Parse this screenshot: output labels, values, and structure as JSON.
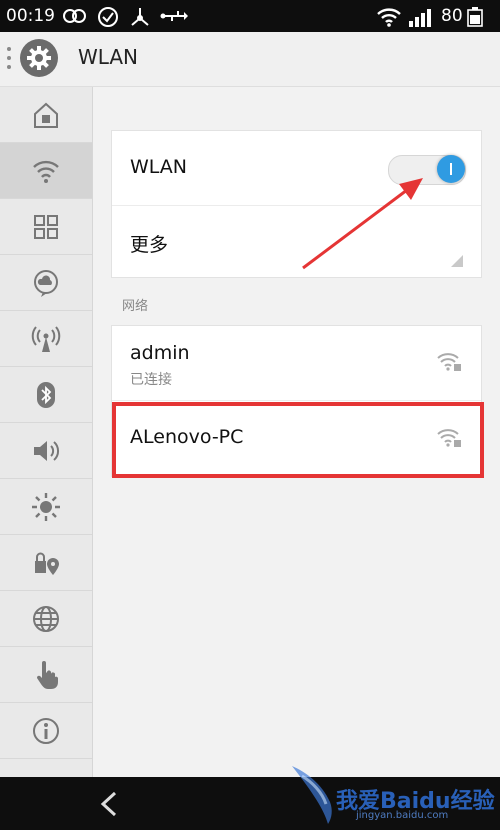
{
  "status_bar": {
    "time": "00:19",
    "battery": "80",
    "icons": [
      "infinity-icon",
      "check-circle-icon",
      "share-icon",
      "usb-icon",
      "wifi-icon",
      "signal-icon"
    ]
  },
  "header": {
    "title": "WLAN",
    "icon": "settings-gear-icon"
  },
  "sidebar": {
    "items": [
      {
        "name": "home-icon",
        "active": false
      },
      {
        "name": "wifi-icon",
        "active": true
      },
      {
        "name": "grid-icon",
        "active": false
      },
      {
        "name": "cloud-chat-icon",
        "active": false
      },
      {
        "name": "hotspot-icon",
        "active": false
      },
      {
        "name": "bluetooth-icon",
        "active": false
      },
      {
        "name": "volume-icon",
        "active": false
      },
      {
        "name": "brightness-icon",
        "active": false
      },
      {
        "name": "lock-location-icon",
        "active": false
      },
      {
        "name": "globe-icon",
        "active": false
      },
      {
        "name": "hand-icon",
        "active": false
      },
      {
        "name": "info-icon",
        "active": false
      }
    ]
  },
  "wlan_card": {
    "wlan_label": "WLAN",
    "toggle_on": true,
    "more_label": "更多"
  },
  "networks": {
    "section_title": "网络",
    "items": [
      {
        "name": "admin",
        "status": "已连接"
      },
      {
        "name": "ALenovo-PC",
        "status": ""
      }
    ]
  },
  "watermark": {
    "text": "我爱Baidu经验",
    "url": "jingyan.baidu.com"
  },
  "colors": {
    "accent": "#2f9be2",
    "highlight": "#e53535",
    "bars": "#0e0e0e"
  }
}
